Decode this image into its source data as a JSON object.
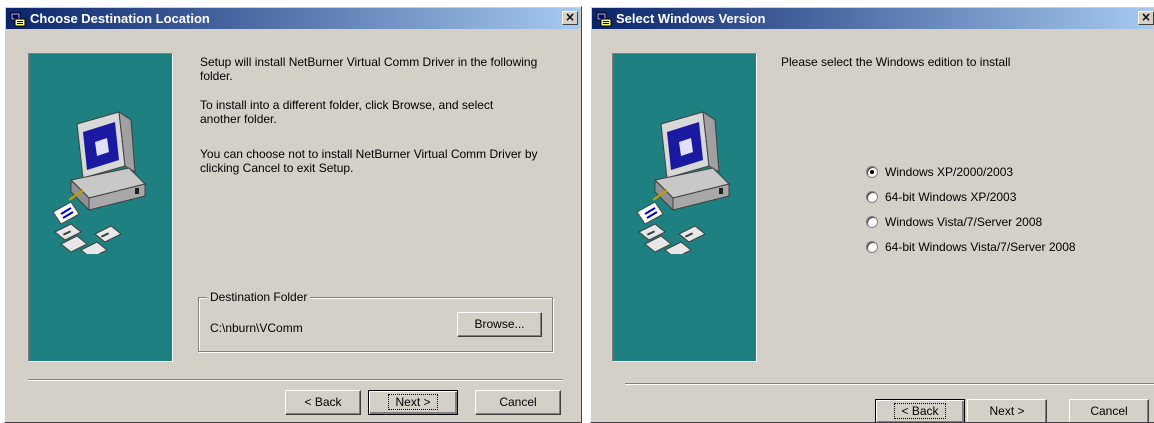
{
  "dialog1": {
    "title": "Choose Destination Location",
    "close_glyph": "×",
    "message1_line1": "Setup will install NetBurner Virtual Comm Driver in the following",
    "message1_line2": "folder.",
    "message2_line1": "To install into a different folder, click Browse, and select",
    "message2_line2": "another folder.",
    "message3_line1": "You can choose not to install NetBurner Virtual Comm Driver by",
    "message3_line2": "clicking Cancel to exit Setup.",
    "group_label": "Destination Folder",
    "destination_path": "C:\\nburn\\VComm",
    "browse_label": "Browse...",
    "back_label": "< Back",
    "next_label": "Next >",
    "cancel_label": "Cancel"
  },
  "dialog2": {
    "title": "Select Windows Version",
    "close_glyph": "×",
    "prompt": "Please select the Windows edition to install",
    "options": [
      {
        "label": "Windows XP/2000/2003",
        "checked": true
      },
      {
        "label": "64-bit Windows XP/2003",
        "checked": false
      },
      {
        "label": "Windows Vista/7/Server 2008",
        "checked": false
      },
      {
        "label": "64-bit Windows Vista/7/Server 2008",
        "checked": false
      }
    ],
    "back_label": "< Back",
    "next_label": "Next >",
    "cancel_label": "Cancel"
  },
  "icons": [
    "installer-app-icon",
    "computer-with-disks-icon"
  ],
  "colors": {
    "titlebar_start": "#0a246a",
    "titlebar_end": "#a6caf0",
    "dialog_face": "#d4d0c8",
    "banner_teal": "#1e8080"
  }
}
